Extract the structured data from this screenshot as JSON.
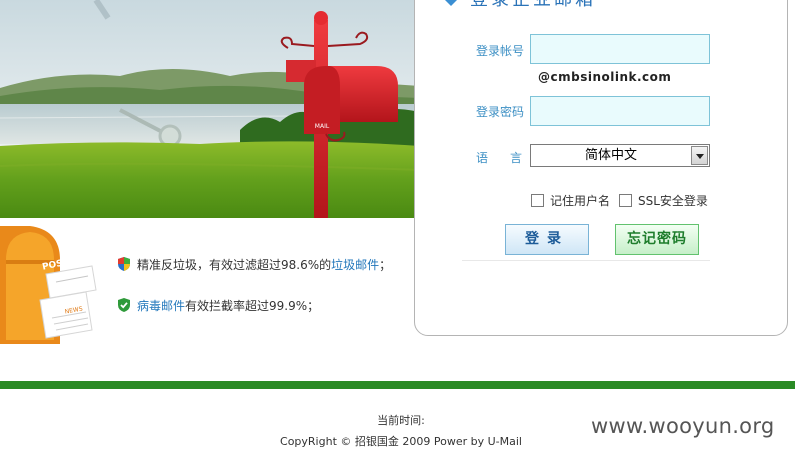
{
  "hero": {
    "mailbox_label": "MAIL"
  },
  "promo": {
    "post_label": "POST",
    "news_label": "NEWS",
    "features": [
      {
        "text": "精准反垃圾，有效过滤超过98.6%的",
        "link": "垃圾邮件",
        "suffix": "；"
      },
      {
        "link": "病毒邮件",
        "text": "有效拦截率超过99.9%；"
      }
    ]
  },
  "login": {
    "title": "登录企业邮箱",
    "account_label": "登录帐号",
    "account_value": "",
    "domain_suffix": "@cmbsinolink.com",
    "password_label": "登录密码",
    "password_value": "",
    "language_label_1": "语",
    "language_label_2": "言",
    "language_selected": "简体中文",
    "remember_label": "记住用户名",
    "ssl_label": "SSL安全登录",
    "login_button": "登录",
    "forgot_button": "忘记密码"
  },
  "footer": {
    "time_label": "当前时间:",
    "copyright": "CopyRight © 招银国金 2009  Power by U-Mail"
  },
  "watermark": "www.wooyun.org",
  "colors": {
    "accent_blue": "#2a73b8",
    "label_blue": "#3c8fc4",
    "input_bg": "#e9fbfd",
    "footer_green": "#2a8a25",
    "mailbox_red": "#d8282e",
    "post_orange": "#f29a1e"
  },
  "icons": {
    "title": "diamond-icon",
    "feature_1": "shield-colored-icon",
    "feature_2": "shield-green-check-icon",
    "language": "chevron-down-icon"
  }
}
